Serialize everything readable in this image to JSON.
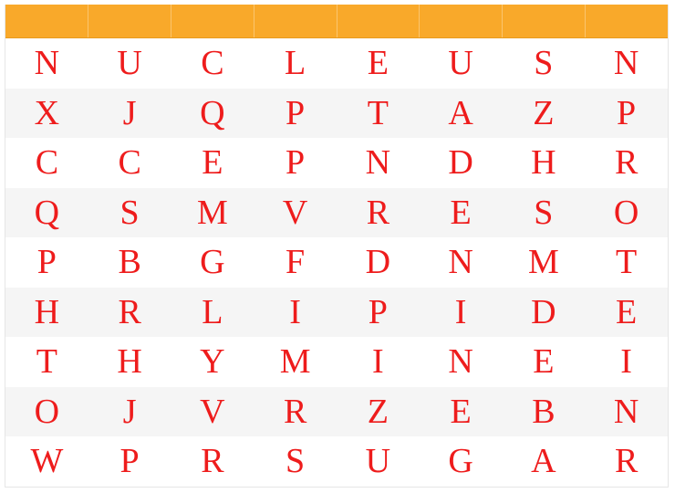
{
  "puzzle": {
    "header_labels": [
      "",
      "",
      "",
      "",
      "",
      "",
      "",
      ""
    ],
    "colors": {
      "header": "#f9a92a",
      "letter": "#ee1c1c",
      "row_alt": "#f5f5f5",
      "row": "#ffffff"
    },
    "grid": [
      [
        "N",
        "U",
        "C",
        "L",
        "E",
        "U",
        "S",
        "N"
      ],
      [
        "X",
        "J",
        "Q",
        "P",
        "T",
        "A",
        "Z",
        "P"
      ],
      [
        "C",
        "C",
        "E",
        "P",
        "N",
        "D",
        "H",
        "R"
      ],
      [
        "Q",
        "S",
        "M",
        "V",
        "R",
        "E",
        "S",
        "O"
      ],
      [
        "P",
        "B",
        "G",
        "F",
        "D",
        "N",
        "M",
        "T"
      ],
      [
        "H",
        "R",
        "L",
        "I",
        "P",
        "I",
        "D",
        "E"
      ],
      [
        "T",
        "H",
        "Y",
        "M",
        "I",
        "N",
        "E",
        "I"
      ],
      [
        "O",
        "J",
        "V",
        "R",
        "Z",
        "E",
        "B",
        "N"
      ],
      [
        "W",
        "P",
        "R",
        "S",
        "U",
        "G",
        "A",
        "R"
      ]
    ]
  }
}
